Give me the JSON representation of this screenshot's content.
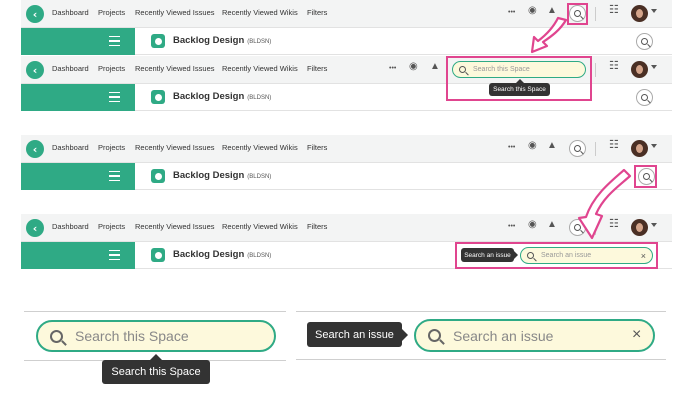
{
  "topbar": {
    "nav_dashboard": "Dashboard",
    "nav_projects": "Projects",
    "nav_recent_issues": "Recently Viewed Issues",
    "nav_recent_wikis": "Recently Viewed Wikis",
    "nav_filters": "Filters",
    "more_label": "•••"
  },
  "project": {
    "title": "Backlog Design",
    "key": "(BLDSN)"
  },
  "search_space": {
    "placeholder": "Search this Space",
    "tooltip": "Search this Space"
  },
  "search_issue": {
    "placeholder": "Search an issue",
    "tooltip": "Search an issue",
    "clear_label": "×"
  },
  "colors": {
    "brand_green": "#2faa85",
    "highlight_pink": "#e0458f",
    "search_fill": "#fdf9dc",
    "tooltip_bg": "#333333"
  },
  "icons": [
    "logo-icon",
    "eye-icon",
    "bell-icon",
    "search-icon",
    "apps-grid-icon",
    "avatar",
    "hamburger-icon",
    "project-icon",
    "close-icon"
  ]
}
